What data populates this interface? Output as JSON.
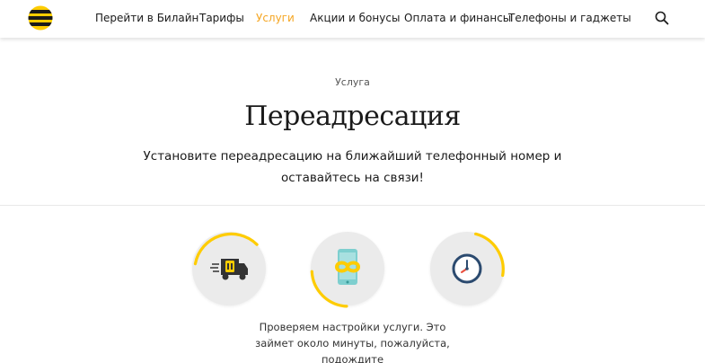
{
  "header": {
    "logo_icon": "beeline-logo-icon",
    "nav": [
      {
        "label": "Перейти в Билайн",
        "active": false
      },
      {
        "label": "Тарифы",
        "active": false
      },
      {
        "label": "Услуги",
        "active": true
      },
      {
        "label": "Акции и бонусы",
        "active": false
      },
      {
        "label": "Оплата и финансы",
        "active": false
      },
      {
        "label": "Телефоны и гаджеты",
        "active": false
      }
    ],
    "search_icon": "search-icon"
  },
  "hero": {
    "eyebrow": "Услуга",
    "title": "Переадресация",
    "subtitle": "Установите переадресацию на ближайший телефонный номер и оставайтесь на связи!"
  },
  "steps": [
    {
      "icon": "delivery-truck-sim-icon"
    },
    {
      "icon": "phone-infinity-icon"
    },
    {
      "icon": "clock-icon"
    }
  ],
  "status": {
    "text": "Проверяем настройки услуги. Это займет около минуты, пожалуйста, подождите"
  },
  "colors": {
    "accent": "#f5a623",
    "brand_yellow": "#fecc00",
    "text": "#1a1a1a"
  }
}
